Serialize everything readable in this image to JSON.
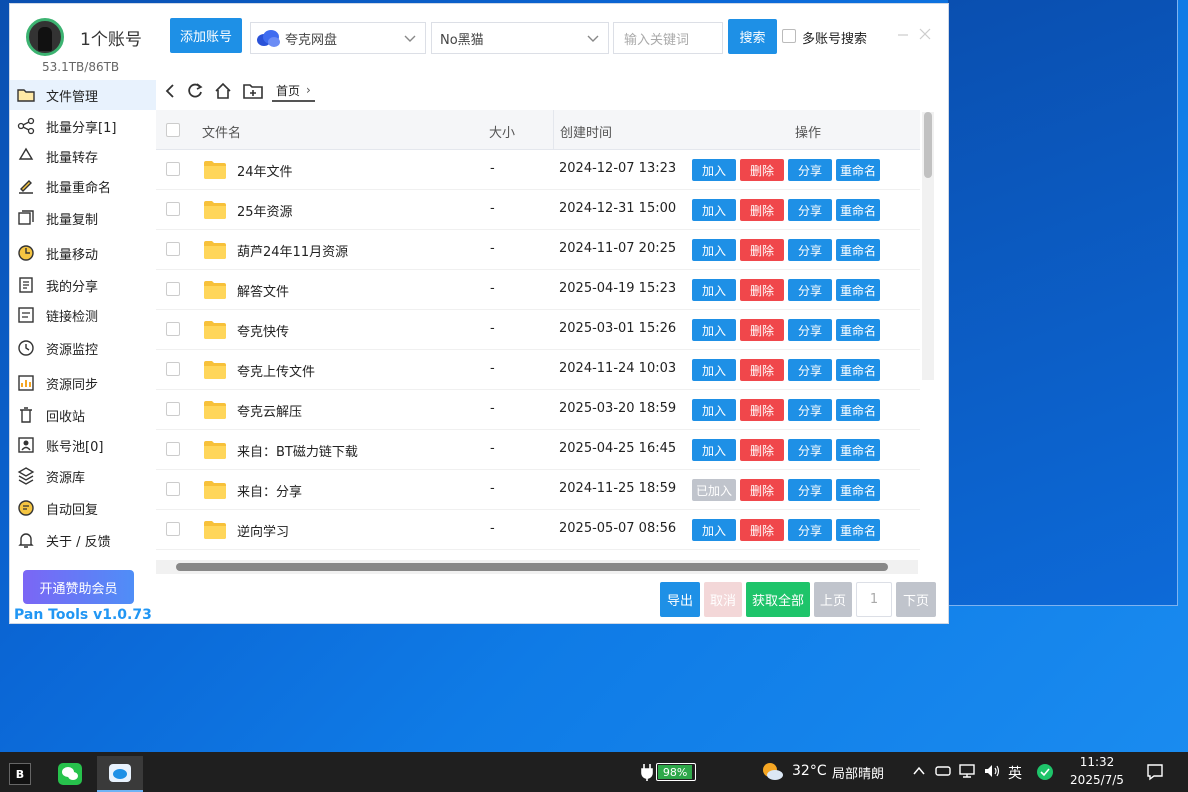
{
  "account": {
    "title": "1个账号",
    "storage": "53.1TB/86TB"
  },
  "sidebar": {
    "items": [
      {
        "label": "文件管理",
        "icon": "folder-icon"
      },
      {
        "label": "批量分享[1]",
        "icon": "share-icon"
      },
      {
        "label": "批量转存",
        "icon": "recycle-icon"
      },
      {
        "label": "批量重命名",
        "icon": "rename-icon"
      },
      {
        "label": "批量复制",
        "icon": "copy-icon"
      },
      {
        "label": "批量移动",
        "icon": "move-icon"
      },
      {
        "label": "我的分享",
        "icon": "my-share-icon"
      },
      {
        "label": "链接检测",
        "icon": "link-check-icon"
      },
      {
        "label": "资源监控",
        "icon": "monitor-icon"
      },
      {
        "label": "资源同步",
        "icon": "sync-icon"
      },
      {
        "label": "回收站",
        "icon": "trash-icon"
      },
      {
        "label": "账号池[0]",
        "icon": "account-pool-icon"
      },
      {
        "label": "资源库",
        "icon": "library-icon"
      },
      {
        "label": "自动回复",
        "icon": "auto-reply-icon"
      },
      {
        "label": "关于 / 反馈",
        "icon": "bell-icon"
      }
    ]
  },
  "vip_button": "开通赞助会员",
  "version": "Pan Tools v1.0.73",
  "toolbar": {
    "add_account": "添加账号",
    "drive_select": "夸克网盘",
    "filter_select": "No黑猫",
    "search_placeholder": "输入关键词",
    "search_button": "搜索",
    "multi_search_label": "多账号搜索"
  },
  "breadcrumb": "首页",
  "table": {
    "headers": {
      "name": "文件名",
      "size": "大小",
      "created": "创建时间",
      "actions": "操作"
    },
    "rows": [
      {
        "name": "24年文件",
        "size": "-",
        "created": "2024-12-07 13:23",
        "add": "加入"
      },
      {
        "name": "25年资源",
        "size": "-",
        "created": "2024-12-31 15:00",
        "add": "加入"
      },
      {
        "name": "葫芦24年11月资源",
        "size": "-",
        "created": "2024-11-07 20:25",
        "add": "加入"
      },
      {
        "name": "解答文件",
        "size": "-",
        "created": "2025-04-19 15:23",
        "add": "加入"
      },
      {
        "name": "夸克快传",
        "size": "-",
        "created": "2025-03-01 15:26",
        "add": "加入"
      },
      {
        "name": "夸克上传文件",
        "size": "-",
        "created": "2024-11-24 10:03",
        "add": "加入"
      },
      {
        "name": "夸克云解压",
        "size": "-",
        "created": "2025-03-20 18:59",
        "add": "加入"
      },
      {
        "name": "来自：BT磁力链下载",
        "size": "-",
        "created": "2025-04-25 16:45",
        "add": "加入"
      },
      {
        "name": "来自：分享",
        "size": "-",
        "created": "2024-11-25 18:59",
        "add": "已加入"
      },
      {
        "name": "逆向学习",
        "size": "-",
        "created": "2025-05-07 08:56",
        "add": "加入"
      }
    ],
    "action_labels": {
      "delete": "删除",
      "share": "分享",
      "rename": "重命名"
    }
  },
  "footer": {
    "export": "导出",
    "cancel": "取消",
    "get_all": "获取全部",
    "prev": "上页",
    "page": "1",
    "next": "下页"
  },
  "taskbar": {
    "battery": "98%",
    "weather": "32°C",
    "weather_desc": "局部晴朗",
    "ime": "英",
    "time": "11:32",
    "date": "2025/7/5"
  }
}
